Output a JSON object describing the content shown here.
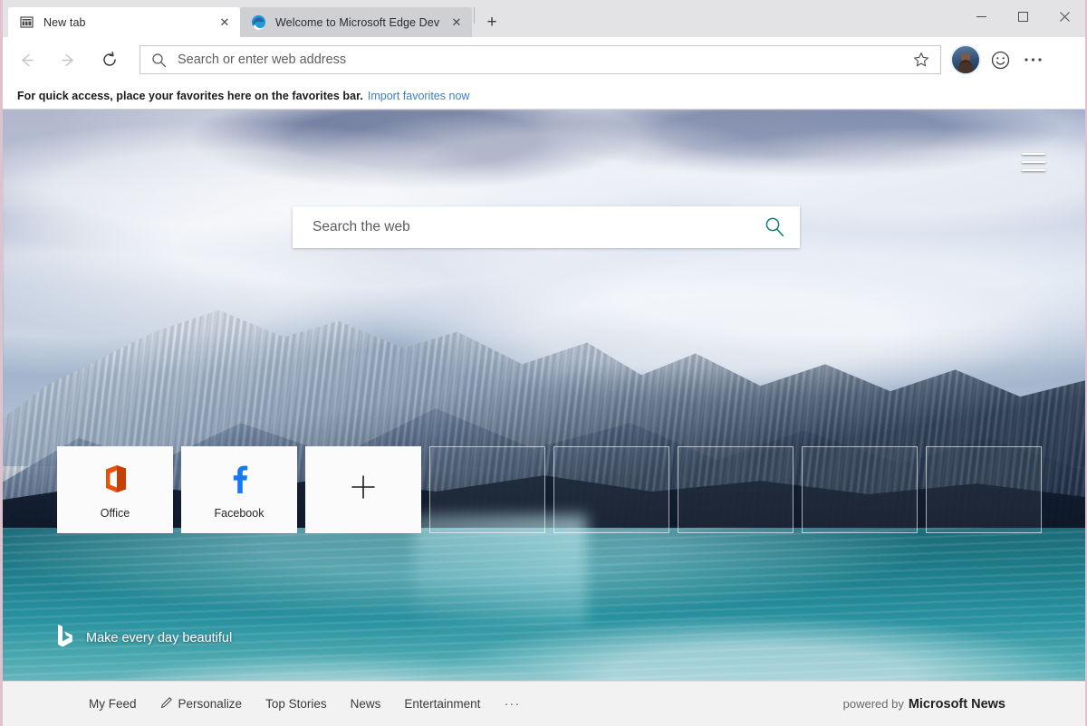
{
  "window": {
    "controls": [
      {
        "name": "minimize-button",
        "glyph": "─"
      },
      {
        "name": "maximize-button",
        "glyph": "☐"
      },
      {
        "name": "close-button",
        "glyph": "✕"
      }
    ]
  },
  "tabs": [
    {
      "title": "New tab",
      "favicon": "new-tab-page-icon",
      "active": true,
      "close_glyph": "✕"
    },
    {
      "title": "Welcome to Microsoft Edge Dev",
      "favicon": "edge-logo-icon",
      "active": false,
      "close_glyph": "✕"
    }
  ],
  "new_tab_button": {
    "label": "+",
    "tooltip": "New tab"
  },
  "toolbar": {
    "back": {
      "name": "back-button",
      "enabled": false
    },
    "forward": {
      "name": "forward-button",
      "enabled": false
    },
    "refresh": {
      "name": "refresh-button",
      "enabled": true
    },
    "address": {
      "value": "",
      "placeholder": "Search or enter web address"
    },
    "favorite_star": "favorites-star-icon",
    "profile": "profile-avatar",
    "feedback": "feedback-smiley-icon",
    "settings": "settings-more-icon"
  },
  "favorites_bar": {
    "message": "For quick access, place your favorites here on the favorites bar.",
    "link": "Import favorites now"
  },
  "newtab": {
    "menu_icon": "hamburger-menu-icon",
    "search": {
      "placeholder": "Search the web",
      "button_icon": "search-magnifier-icon",
      "accent": "#107c6d"
    },
    "tiles": [
      {
        "label": "Office",
        "icon": "office-logo-icon",
        "type": "filled"
      },
      {
        "label": "Facebook",
        "icon": "facebook-logo-icon",
        "type": "filled"
      },
      {
        "label": "",
        "icon": "add-tile-plus-icon",
        "type": "add"
      },
      {
        "label": "",
        "icon": "",
        "type": "empty"
      },
      {
        "label": "",
        "icon": "",
        "type": "empty"
      },
      {
        "label": "",
        "icon": "",
        "type": "empty"
      },
      {
        "label": "",
        "icon": "",
        "type": "empty"
      },
      {
        "label": "",
        "icon": "",
        "type": "empty"
      }
    ],
    "bing": {
      "icon": "bing-logo-icon",
      "tagline": "Make every day beautiful"
    }
  },
  "footer": {
    "nav": [
      {
        "label": "My Feed",
        "icon": ""
      },
      {
        "label": "Personalize",
        "icon": "pencil-edit-icon"
      },
      {
        "label": "Top Stories",
        "icon": ""
      },
      {
        "label": "News",
        "icon": ""
      },
      {
        "label": "Entertainment",
        "icon": ""
      }
    ],
    "overflow": "···",
    "powered_by_prefix": "powered by",
    "powered_by_brand": "Microsoft News"
  },
  "colors": {
    "frame_accent": "#dec2ce",
    "titlebar": "#e3e3e6",
    "tab_inactive": "#cfd0d4",
    "link": "#3d7fc1",
    "office_orange": "#e8500f",
    "facebook_blue": "#1877f2",
    "bing_teal": "#107c6d"
  }
}
